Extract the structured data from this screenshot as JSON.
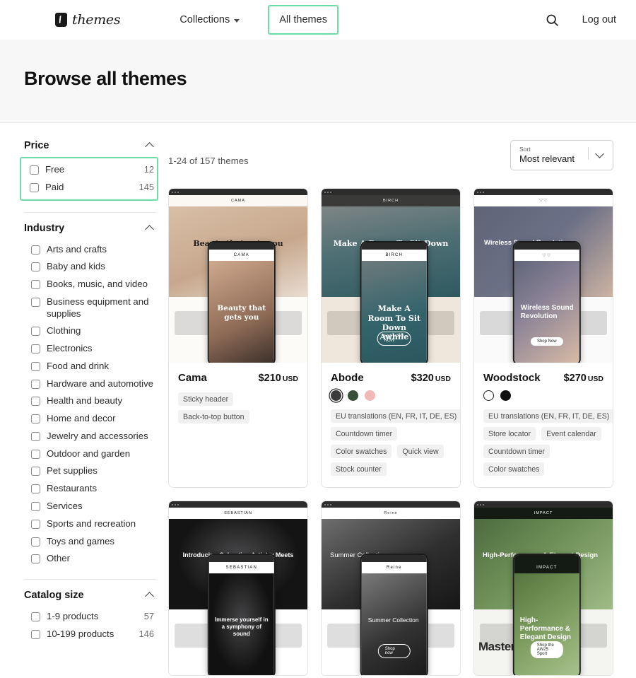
{
  "header": {
    "brand_word": "themes",
    "brand_icon": "shopify-bag-icon",
    "nav": [
      {
        "label": "Collections",
        "has_caret": true,
        "highlighted": false
      },
      {
        "label": "All themes",
        "has_caret": false,
        "highlighted": true
      }
    ],
    "search_icon": "search-icon",
    "logout_label": "Log out",
    "highlight_color": "#6fdba6"
  },
  "hero": {
    "title": "Browse all themes"
  },
  "sidebar": {
    "facets": [
      {
        "title": "Price",
        "highlighted": true,
        "options": [
          {
            "label": "Free",
            "count": "12"
          },
          {
            "label": "Paid",
            "count": "145"
          }
        ]
      },
      {
        "title": "Industry",
        "highlighted": false,
        "options": [
          {
            "label": "Arts and crafts",
            "count": ""
          },
          {
            "label": "Baby and kids",
            "count": ""
          },
          {
            "label": "Books, music, and video",
            "count": ""
          },
          {
            "label": "Business equipment and supplies",
            "count": ""
          },
          {
            "label": "Clothing",
            "count": ""
          },
          {
            "label": "Electronics",
            "count": ""
          },
          {
            "label": "Food and drink",
            "count": ""
          },
          {
            "label": "Hardware and automotive",
            "count": ""
          },
          {
            "label": "Health and beauty",
            "count": ""
          },
          {
            "label": "Home and decor",
            "count": ""
          },
          {
            "label": "Jewelry and accessories",
            "count": ""
          },
          {
            "label": "Outdoor and garden",
            "count": ""
          },
          {
            "label": "Pet supplies",
            "count": ""
          },
          {
            "label": "Restaurants",
            "count": ""
          },
          {
            "label": "Services",
            "count": ""
          },
          {
            "label": "Sports and recreation",
            "count": ""
          },
          {
            "label": "Toys and games",
            "count": ""
          },
          {
            "label": "Other",
            "count": ""
          }
        ]
      },
      {
        "title": "Catalog size",
        "highlighted": false,
        "options": [
          {
            "label": "1-9 products",
            "count": "57"
          },
          {
            "label": "10-199 products",
            "count": "146"
          }
        ]
      }
    ]
  },
  "results": {
    "count_text": "1-24 of 157 themes",
    "sort": {
      "label": "Sort",
      "value": "Most relevant"
    },
    "cards": [
      {
        "name": "Cama",
        "price": "$210",
        "currency": "USD",
        "swatches": [],
        "tags": [
          "Sticky header",
          "Back-to-top button"
        ],
        "preview": {
          "theme_class": "t-cama",
          "logo": "CAMA",
          "headline": "Beauty that gets you",
          "phone_headline": "Beauty that gets you",
          "cta": ""
        }
      },
      {
        "name": "Abode",
        "price": "$320",
        "currency": "USD",
        "swatches": [
          {
            "name": "charcoal",
            "color": "#3b3b3b",
            "selected": true
          },
          {
            "name": "dark-green",
            "color": "#38503a",
            "selected": false
          },
          {
            "name": "pink",
            "color": "#f2b8b8",
            "selected": false
          }
        ],
        "tags": [
          "EU translations (EN, FR, IT, DE, ES)",
          "Countdown timer",
          "Color swatches",
          "Quick view",
          "Stock counter"
        ],
        "preview": {
          "theme_class": "t-abode",
          "logo": "BIRCH",
          "headline": "Make A Room To Sit Down Awhile",
          "phone_headline": "Make A Room To Sit Down Awhile",
          "cta": "EXPLORE NOW"
        }
      },
      {
        "name": "Woodstock",
        "price": "$270",
        "currency": "USD",
        "swatches": [
          {
            "name": "white",
            "color": "#ffffff",
            "selected": false,
            "outlined": true
          },
          {
            "name": "black",
            "color": "#111111",
            "selected": false
          }
        ],
        "tags": [
          "EU translations (EN, FR, IT, DE, ES)",
          "Store locator",
          "Event calendar",
          "Countdown timer",
          "Color swatches"
        ],
        "preview": {
          "theme_class": "t-wood",
          "logo": "♡♡",
          "headline": "Wireless Sound Revolution",
          "phone_headline": "Wireless Sound Revolution",
          "cta": "Shop Now"
        }
      },
      {
        "name": "",
        "price": "",
        "currency": "",
        "swatches": [],
        "tags": [],
        "preview": {
          "theme_class": "t-seb",
          "logo": "SEBASTIAN",
          "headline": "Introducing Sebastian Artistry Meets Audio",
          "phone_headline": "Immerse yourself in a symphony of sound",
          "cta": ""
        }
      },
      {
        "name": "",
        "price": "",
        "currency": "",
        "swatches": [],
        "tags": [],
        "preview": {
          "theme_class": "t-reine",
          "logo": "Reine",
          "headline": "Summer Collection",
          "phone_headline": "Summer Collection",
          "cta": "Shop now"
        }
      },
      {
        "name": "",
        "price": "",
        "currency": "",
        "swatches": [],
        "tags": [],
        "preview": {
          "theme_class": "t-impact",
          "logo": "IMPACT",
          "headline": "High-Performance & Elegant Design",
          "phone_headline": "High-Performance & Elegant Design",
          "cta": "Shop the AW25 Sport",
          "bigword": "Mastery"
        }
      }
    ]
  }
}
